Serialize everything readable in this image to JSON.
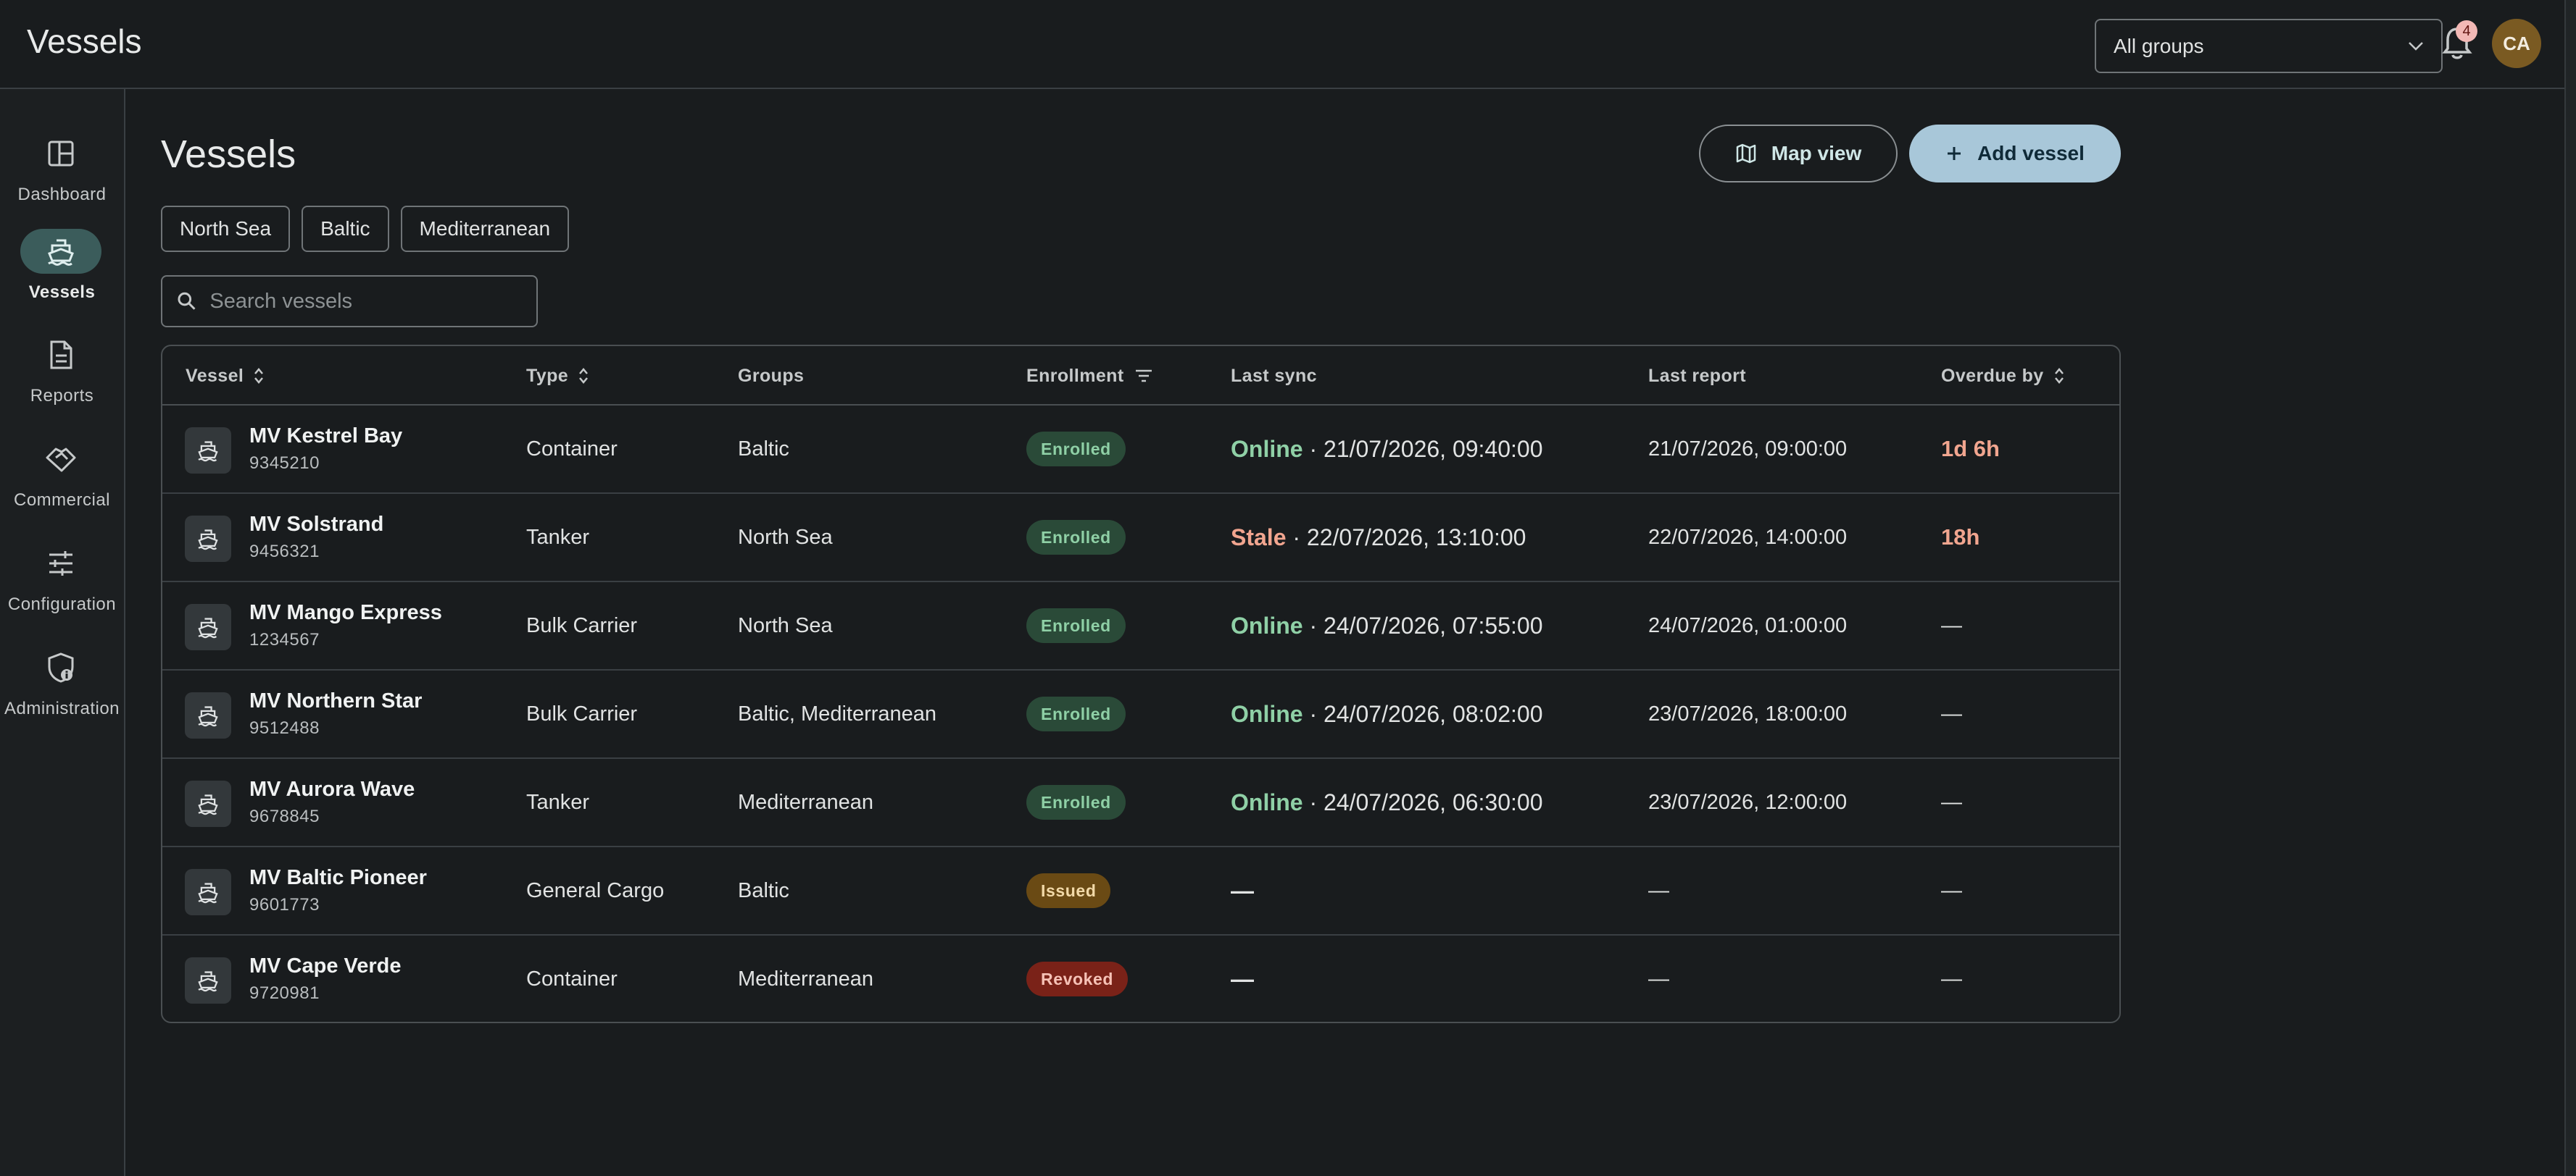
{
  "app": {
    "title": "Vessels"
  },
  "topbar": {
    "group_select": "All groups",
    "notification_count": "4",
    "avatar_initials": "CA"
  },
  "sidebar": {
    "items": [
      {
        "label": "Dashboard",
        "icon": "dashboard-icon",
        "active": false
      },
      {
        "label": "Vessels",
        "icon": "ship-icon",
        "active": true
      },
      {
        "label": "Reports",
        "icon": "document-icon",
        "active": false
      },
      {
        "label": "Commercial",
        "icon": "handshake-icon",
        "active": false
      },
      {
        "label": "Configuration",
        "icon": "sliders-icon",
        "active": false
      },
      {
        "label": "Administration",
        "icon": "admin-shield-icon",
        "active": false
      }
    ]
  },
  "main": {
    "title": "Vessels",
    "map_view_label": "Map view",
    "add_vessel_label": "Add vessel",
    "filter_chips": [
      "North Sea",
      "Baltic",
      "Mediterranean"
    ],
    "search_placeholder": "Search vessels"
  },
  "table": {
    "columns": [
      "Vessel",
      "Type",
      "Groups",
      "Enrollment",
      "Last sync",
      "Last report",
      "Overdue by"
    ],
    "rows": [
      {
        "name": "MV Kestrel Bay",
        "imo": "9345210",
        "type": "Container",
        "groups": "Baltic",
        "enrollment": "Enrolled",
        "sync_status": "Online",
        "sync_time": "21/07/2026, 09:40:00",
        "last_report": "21/07/2026, 09:00:00",
        "overdue": "1d 6h"
      },
      {
        "name": "MV Solstrand",
        "imo": "9456321",
        "type": "Tanker",
        "groups": "North Sea",
        "enrollment": "Enrolled",
        "sync_status": "Stale",
        "sync_time": "22/07/2026, 13:10:00",
        "last_report": "22/07/2026, 14:00:00",
        "overdue": "18h"
      },
      {
        "name": "MV Mango Express",
        "imo": "1234567",
        "type": "Bulk Carrier",
        "groups": "North Sea",
        "enrollment": "Enrolled",
        "sync_status": "Online",
        "sync_time": "24/07/2026, 07:55:00",
        "last_report": "24/07/2026, 01:00:00",
        "overdue": "—"
      },
      {
        "name": "MV Northern Star",
        "imo": "9512488",
        "type": "Bulk Carrier",
        "groups": "Baltic, Mediterranean",
        "enrollment": "Enrolled",
        "sync_status": "Online",
        "sync_time": "24/07/2026, 08:02:00",
        "last_report": "23/07/2026, 18:00:00",
        "overdue": "—"
      },
      {
        "name": "MV Aurora Wave",
        "imo": "9678845",
        "type": "Tanker",
        "groups": "Mediterranean",
        "enrollment": "Enrolled",
        "sync_status": "Online",
        "sync_time": "24/07/2026, 06:30:00",
        "last_report": "23/07/2026, 12:00:00",
        "overdue": "—"
      },
      {
        "name": "MV Baltic Pioneer",
        "imo": "9601773",
        "type": "General Cargo",
        "groups": "Baltic",
        "enrollment": "Issued",
        "sync_status": "",
        "sync_time": "—",
        "last_report": "—",
        "overdue": "—"
      },
      {
        "name": "MV Cape Verde",
        "imo": "9720981",
        "type": "Container",
        "groups": "Mediterranean",
        "enrollment": "Revoked",
        "sync_status": "",
        "sync_time": "—",
        "last_report": "—",
        "overdue": "—"
      }
    ]
  },
  "colors": {
    "background": "#191c1e",
    "accent_button": "#a8c7d9",
    "online": "#8fd0a6",
    "stale": "#f1a58f",
    "overdue": "#f1a58f"
  }
}
